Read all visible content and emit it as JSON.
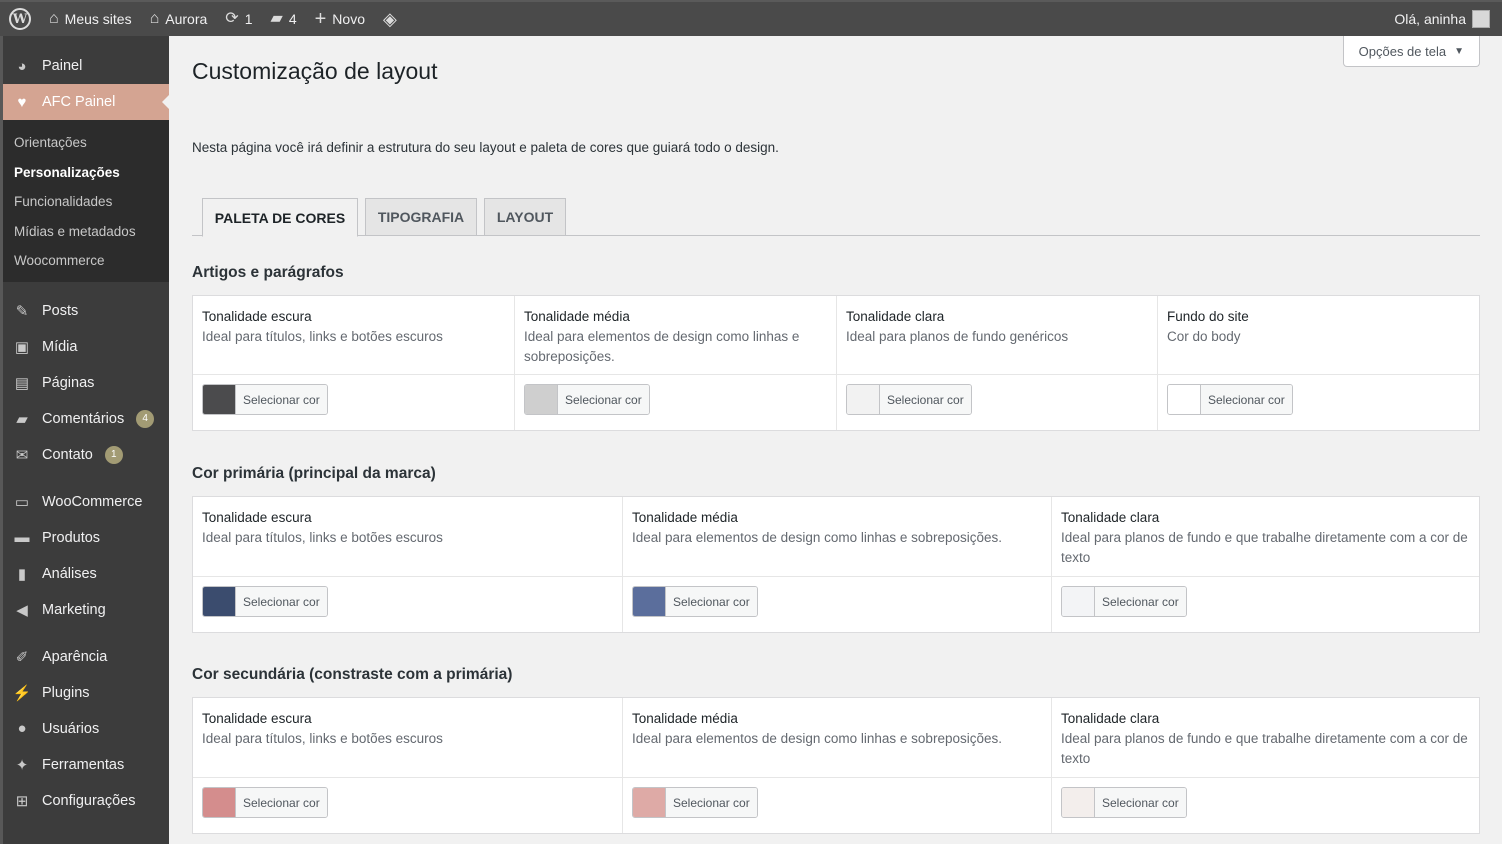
{
  "adminbar": {
    "my_sites": "Meus sites",
    "site_name": "Aurora",
    "updates_count": "1",
    "comments_count": "4",
    "new_label": "Novo",
    "greeting": "Olá, aninha"
  },
  "sidebar": {
    "painel": "Painel",
    "afc_painel": "AFC Painel",
    "submenu": [
      "Orientações",
      "Personalizações",
      "Funcionalidades",
      "Mídias e metadados",
      "Woocommerce"
    ],
    "posts": "Posts",
    "midia": "Mídia",
    "paginas": "Páginas",
    "comentarios": "Comentários",
    "comentarios_badge": "4",
    "contato": "Contato",
    "contato_badge": "1",
    "woocommerce": "WooCommerce",
    "produtos": "Produtos",
    "analises": "Análises",
    "marketing": "Marketing",
    "aparencia": "Aparência",
    "plugins": "Plugins",
    "usuarios": "Usuários",
    "ferramentas": "Ferramentas",
    "configuracoes": "Configurações"
  },
  "screen_options": "Opções de tela",
  "page_title": "Customização de layout",
  "intro": "Nesta página você irá definir a estrutura do seu layout e paleta de cores que guiará todo o design.",
  "tabs": [
    "PALETA DE CORES",
    "TIPOGRAFIA",
    "LAYOUT"
  ],
  "select_color_label": "Selecionar cor",
  "sections": [
    {
      "title": "Artigos e parágrafos",
      "fields": [
        {
          "label": "Tonalidade escura",
          "desc": "Ideal para títulos, links e botões escuros",
          "color": "#4b4b4d"
        },
        {
          "label": "Tonalidade média",
          "desc": "Ideal para elementos de design como linhas e sobreposições.",
          "color": "#cfcfcf"
        },
        {
          "label": "Tonalidade clara",
          "desc": "Ideal para planos de fundo genéricos",
          "color": "#f2f2f2"
        },
        {
          "label": "Fundo do site",
          "desc": "Cor do body",
          "color": "#ffffff"
        }
      ]
    },
    {
      "title": "Cor primária (principal da marca)",
      "fields": [
        {
          "label": "Tonalidade escura",
          "desc": "Ideal para títulos, links e botões escuros",
          "color": "#3b4c6e"
        },
        {
          "label": "Tonalidade média",
          "desc": "Ideal para elementos de design como linhas e sobreposições.",
          "color": "#5b6e9c"
        },
        {
          "label": "Tonalidade clara",
          "desc": "Ideal para planos de fundo e que trabalhe diretamente com a cor de texto",
          "color": "#f3f4f6"
        }
      ]
    },
    {
      "title": "Cor secundária (constraste com a primária)",
      "fields": [
        {
          "label": "Tonalidade escura",
          "desc": "Ideal para títulos, links e botões escuros",
          "color": "#d48d8d"
        },
        {
          "label": "Tonalidade média",
          "desc": "Ideal para elementos de design como linhas e sobreposições.",
          "color": "#deaaa6"
        },
        {
          "label": "Tonalidade clara",
          "desc": "Ideal para planos de fundo e que trabalhe diretamente com a cor de texto",
          "color": "#f3eeec"
        }
      ]
    }
  ]
}
